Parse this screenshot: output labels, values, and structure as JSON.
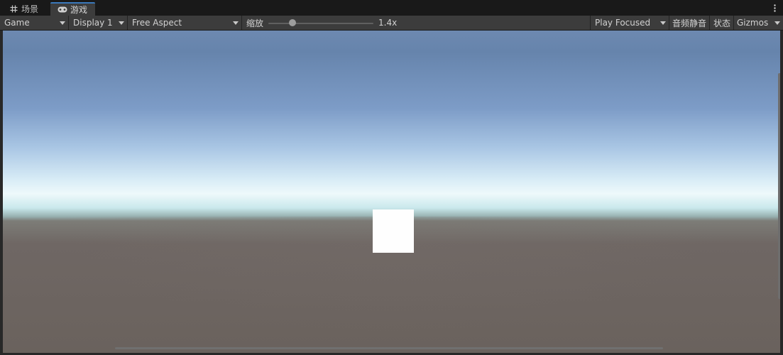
{
  "tabs": {
    "scene_label": "场景",
    "game_label": "游戏",
    "scene_icon": "grid-icon",
    "game_icon": "gamepad-icon"
  },
  "toolbar": {
    "game_dropdown": "Game",
    "display_dropdown": "Display 1",
    "aspect_dropdown": "Free Aspect",
    "zoom_label": "缩放",
    "zoom_value": "1.4x",
    "play_mode_dropdown": "Play Focused",
    "mute_audio_button": "音频静音",
    "stats_button": "状态",
    "gizmos_dropdown": "Gizmos"
  },
  "colors": {
    "accent_tab": "#3a79bb",
    "cube": "#fefefe"
  }
}
